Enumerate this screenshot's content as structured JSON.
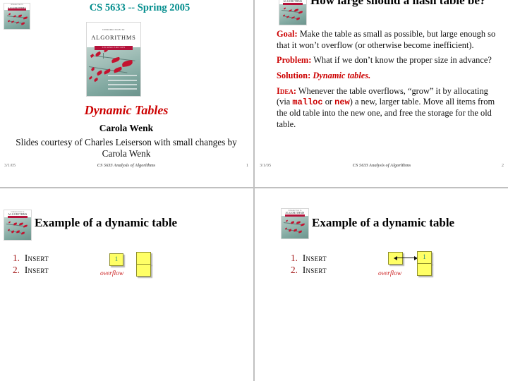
{
  "deck": {
    "slides": [
      {
        "id": "slide-1",
        "header": "CS 5633 -- Spring 2005",
        "title": "Dynamic Tables",
        "author": "Carola Wenk",
        "credit": "Slides courtesy of Charles Leiserson with small changes by Carola Wenk",
        "cover": {
          "intro": "INTRODUCTION TO",
          "title": "ALGORITHMS",
          "edition": "SECOND EDITION"
        },
        "footer": {
          "date": "3/1/05",
          "center": "CS 5633 Analysis of Algorithms",
          "page": "1"
        }
      },
      {
        "id": "slide-2",
        "title": "How large should a hash table be?",
        "paragraphs": [
          {
            "label": "Goal:",
            "text": " Make the table as small as possible, but large enough so that it won’t overflow (or otherwise become inefficient)."
          },
          {
            "label": "Problem:",
            "text": " What if we don’t know the proper size in advance?"
          },
          {
            "label": "Solution:",
            "emphasis": "Dynamic tables."
          },
          {
            "label": "Idea:",
            "text_a": " Whenever the table overflows, “grow” it by allocating (via ",
            "code_a": "malloc",
            "text_b": " or ",
            "code_b": "new",
            "text_c": ") a new, larger table.  Move all items from the old table into the new one, and free the storage for the old table."
          }
        ],
        "footer": {
          "date": "3/1/05",
          "center": "CS 5633 Analysis of Algorithms",
          "page": "2"
        }
      },
      {
        "id": "slide-3",
        "title": "Example of a dynamic table",
        "steps": [
          {
            "num": "1.",
            "op": "Insert"
          },
          {
            "num": "2.",
            "op": "Insert"
          }
        ],
        "overflow_label": "overflow",
        "old_table": {
          "cells": [
            "1"
          ]
        },
        "new_table": {
          "cells": [
            "",
            ""
          ]
        },
        "arrow": false
      },
      {
        "id": "slide-4",
        "title": "Example of a dynamic table",
        "steps": [
          {
            "num": "1.",
            "op": "Insert"
          },
          {
            "num": "2.",
            "op": "Insert"
          }
        ],
        "overflow_label": "overflow",
        "old_table": {
          "cells": [
            ""
          ]
        },
        "new_table": {
          "cells": [
            "1",
            ""
          ]
        },
        "arrow": true
      }
    ]
  },
  "colors": {
    "header_teal": "#008c8c",
    "title_red": "#cc0000",
    "list_number_red": "#a31818",
    "cell_yellow": "#ffff66",
    "cell_text_teal": "#2f8f7a",
    "divider_gray": "#c0c0c0"
  }
}
